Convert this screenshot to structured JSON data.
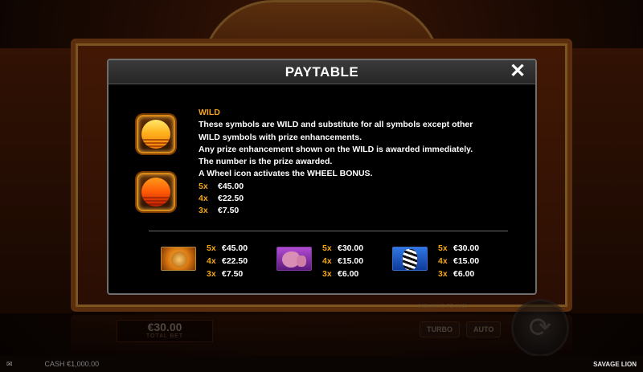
{
  "background": {
    "bet_amount": "€30.00",
    "bet_label": "TOTAL BET",
    "quick_button": "TURBO",
    "auto_button": "AUTO",
    "lines_note": "243 WAYS TO WIN",
    "spin_icon": "spin-arrows-icon"
  },
  "status_bar": {
    "cash_label": "CASH",
    "cash_value": "€1,000.00",
    "game_name": "SAVAGE LION"
  },
  "paytable": {
    "title": "PAYTABLE",
    "close_icon": "✕",
    "wild": {
      "title": "WILD",
      "lines": [
        "These symbols are WILD and substitute for all symbols except other",
        "WILD symbols with prize enhancements.",
        "Any prize enhancement shown on the WILD is awarded immediately.",
        "The number is the prize awarded.",
        "A Wheel icon activates the WHEEL BONUS."
      ],
      "prizes": [
        {
          "mult": "5x",
          "value": "€45.00"
        },
        {
          "mult": "4x",
          "value": "€22.50"
        },
        {
          "mult": "3x",
          "value": "€7.50"
        }
      ]
    },
    "symbols": [
      {
        "name": "lion",
        "prizes": [
          {
            "mult": "5x",
            "value": "€45.00"
          },
          {
            "mult": "4x",
            "value": "€22.50"
          },
          {
            "mult": "3x",
            "value": "€7.50"
          }
        ]
      },
      {
        "name": "elephant",
        "prizes": [
          {
            "mult": "5x",
            "value": "€30.00"
          },
          {
            "mult": "4x",
            "value": "€15.00"
          },
          {
            "mult": "3x",
            "value": "€6.00"
          }
        ]
      },
      {
        "name": "zebra",
        "prizes": [
          {
            "mult": "5x",
            "value": "€30.00"
          },
          {
            "mult": "4x",
            "value": "€15.00"
          },
          {
            "mult": "3x",
            "value": "€6.00"
          }
        ]
      }
    ]
  },
  "colors": {
    "accent_gold": "#f3a517",
    "modal_bg": "#000000",
    "header_bg": "#2e2e2e"
  }
}
